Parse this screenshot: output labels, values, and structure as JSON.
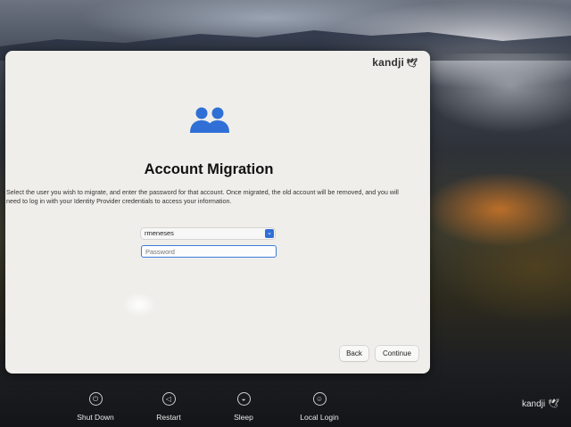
{
  "dialog": {
    "brand": "kandji",
    "brand_icon": "bird-logo",
    "icon": "users-icon",
    "title": "Account Migration",
    "description": "Select the user you wish to migrate, and enter the password for that account. Once migrated, the old account will be removed, and you will need to log in with your Identity Provider credentials to access your information.",
    "user_select": {
      "value": "rmeneses"
    },
    "password": {
      "placeholder": "Password",
      "value": ""
    },
    "buttons": {
      "back": "Back",
      "continue": "Continue"
    }
  },
  "bottom_bar": {
    "items": [
      {
        "label": "Shut Down",
        "icon": "power-icon"
      },
      {
        "label": "Restart",
        "icon": "restart-icon"
      },
      {
        "label": "Sleep",
        "icon": "sleep-icon"
      },
      {
        "label": "Local Login",
        "icon": "user-icon"
      }
    ],
    "brand": "kandji"
  },
  "colors": {
    "accent": "#2f6fd6",
    "dialog_bg": "#efeeea"
  }
}
